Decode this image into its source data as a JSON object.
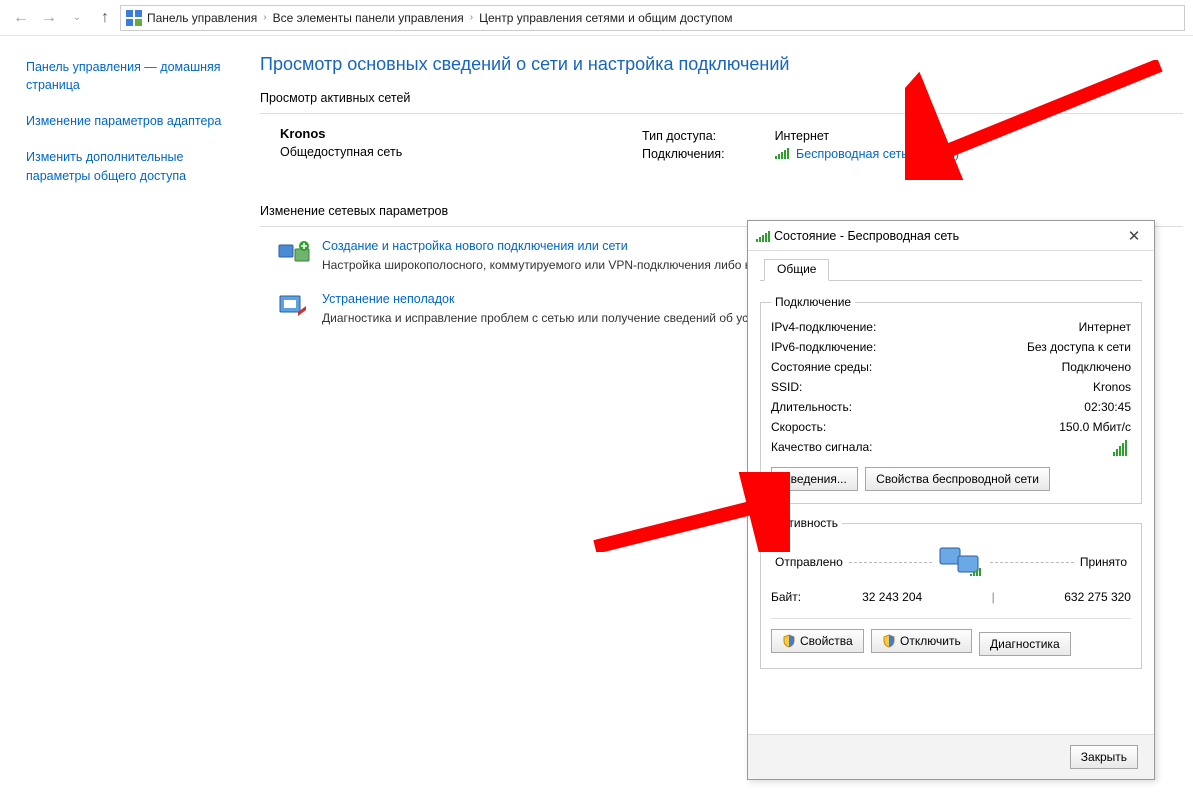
{
  "breadcrumb": {
    "items": [
      "Панель управления",
      "Все элементы панели управления",
      "Центр управления сетями и общим доступом"
    ]
  },
  "sidebar": {
    "items": [
      "Панель управления — домашняя страница",
      "Изменение параметров адаптера",
      "Изменить дополнительные параметры общего доступа"
    ]
  },
  "content": {
    "title": "Просмотр основных сведений о сети и настройка подключений",
    "active_networks_label": "Просмотр активных сетей",
    "network": {
      "name": "Kronos",
      "category": "Общедоступная сеть",
      "access_label": "Тип доступа:",
      "access_value": "Интернет",
      "conn_label": "Подключения:",
      "conn_value": "Беспроводная сеть (Kronos)"
    },
    "change_label": "Изменение сетевых параметров",
    "items": [
      {
        "title": "Создание и настройка нового подключения или сети",
        "desc": "Настройка широкополосного, коммутируемого или VPN-подключения либо настройка маршрутизатора или точки доступа."
      },
      {
        "title": "Устранение неполадок",
        "desc": "Диагностика и исправление проблем с сетью или получение сведений об устранении неполадок."
      }
    ]
  },
  "dialog": {
    "title": "Состояние - Беспроводная сеть",
    "tab": "Общие",
    "group_conn": "Подключение",
    "rows": {
      "ipv4_l": "IPv4-подключение:",
      "ipv4_v": "Интернет",
      "ipv6_l": "IPv6-подключение:",
      "ipv6_v": "Без доступа к сети",
      "media_l": "Состояние среды:",
      "media_v": "Подключено",
      "ssid_l": "SSID:",
      "ssid_v": "Kronos",
      "dur_l": "Длительность:",
      "dur_v": "02:30:45",
      "speed_l": "Скорость:",
      "speed_v": "150.0 Мбит/с",
      "signal_l": "Качество сигнала:"
    },
    "btn_details": "Сведения...",
    "btn_wprops": "Свойства беспроводной сети",
    "group_activity": "Активность",
    "sent_l": "Отправлено",
    "recv_l": "Принято",
    "bytes_l": "Байт:",
    "bytes_sent": "32 243 204",
    "bytes_recv": "632 275 320",
    "btn_props": "Свойства",
    "btn_disable": "Отключить",
    "btn_diag": "Диагностика",
    "btn_close": "Закрыть"
  }
}
